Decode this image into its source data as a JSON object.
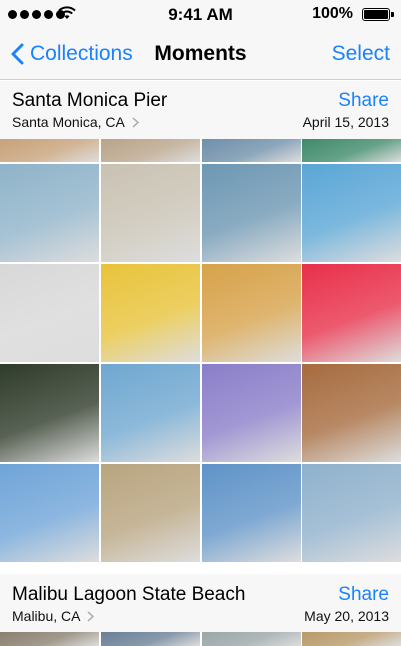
{
  "status_bar": {
    "time": "9:41 AM",
    "battery_percent": "100%",
    "signal_dots": 5
  },
  "nav": {
    "back_label": "Collections",
    "title": "Moments",
    "select_label": "Select"
  },
  "theme": {
    "accent": "#1a82fb",
    "bar_background": "#f7f7f7"
  },
  "sections": [
    {
      "title": "Santa Monica Pier",
      "location": "Santa Monica, CA",
      "share_label": "Share",
      "date": "April 15, 2013"
    },
    {
      "title": "Malibu Lagoon State Beach",
      "location": "Malibu, CA",
      "share_label": "Share",
      "date": "May 20, 2013"
    }
  ],
  "photos": {
    "partial_top_row": [
      "#c7a27a",
      "#b9a48a",
      "#6f8faa",
      "#3f8a6a"
    ],
    "rows": [
      [
        "#8fb3c9",
        "#c9c2b3",
        "#6d97b3",
        "#5aa6d6"
      ],
      [
        "#d8d8d8",
        "#e8c33a",
        "#d7a24a",
        "#e8304a"
      ],
      [
        "#2f3b2a",
        "#6fa7d0",
        "#8a7ec9",
        "#a66b3e"
      ],
      [
        "#6fa4d8",
        "#b8a47f",
        "#5f93c8",
        "#8fb1cc"
      ]
    ],
    "partial_bottom_row": [
      "#8a8070",
      "#6a7f96",
      "#9aa6a8",
      "#b89a6a"
    ]
  }
}
